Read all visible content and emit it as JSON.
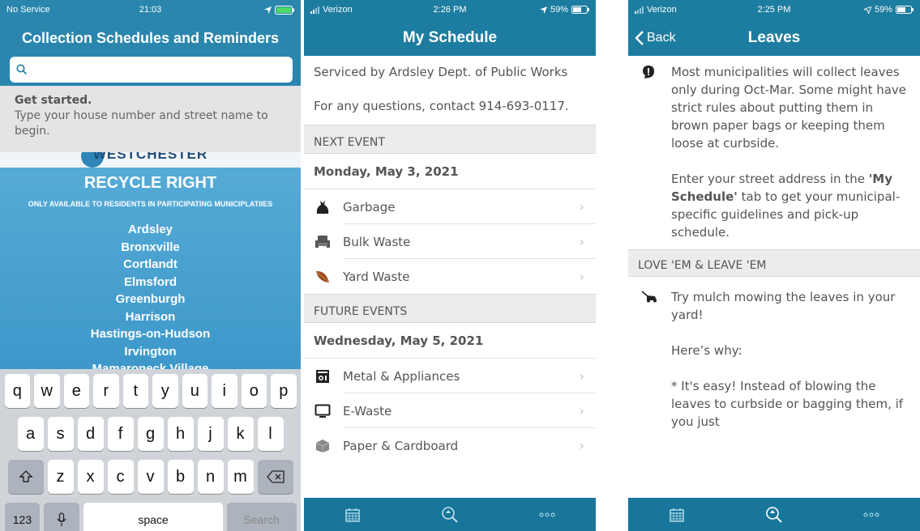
{
  "phone1": {
    "status": {
      "carrier": "No Service",
      "time": "21:03"
    },
    "title": "Collection Schedules and Reminders",
    "search": {
      "placeholder": "",
      "value": ""
    },
    "get_started": {
      "heading": "Get started.",
      "body": "Type your house number and street name to begin."
    },
    "poster": {
      "brand": "WESTCHESTER",
      "title": "RECYCLE RIGHT",
      "subtitle": "ONLY AVAILABLE TO RESIDENTS IN PARTICIPATING MUNICIPLATIIES",
      "municipalities": [
        "Ardsley",
        "Bronxville",
        "Cortlandt",
        "Elmsford",
        "Greenburgh",
        "Harrison",
        "Hastings-on-Hudson",
        "Irvington",
        "Mamaroneck Village"
      ]
    },
    "keyboard": {
      "row1": [
        "q",
        "w",
        "e",
        "r",
        "t",
        "y",
        "u",
        "i",
        "o",
        "p"
      ],
      "row2": [
        "a",
        "s",
        "d",
        "f",
        "g",
        "h",
        "j",
        "k",
        "l"
      ],
      "row3": [
        "z",
        "x",
        "c",
        "v",
        "b",
        "n",
        "m"
      ],
      "numbers_label": "123",
      "space_label": "space",
      "search_label": "Search"
    }
  },
  "phone2": {
    "status": {
      "carrier": "Verizon",
      "time": "2:26 PM",
      "battery": "59%"
    },
    "title": "My Schedule",
    "serviced_by": "Serviced by Ardsley Dept. of Public Works",
    "contact": "For any questions, contact 914-693-0117.",
    "next_event": {
      "label": "NEXT EVENT",
      "date": "Monday, May 3, 2021",
      "items": [
        {
          "label": "Garbage",
          "icon": "garbage-bag-icon"
        },
        {
          "label": "Bulk Waste",
          "icon": "armchair-icon"
        },
        {
          "label": "Yard Waste",
          "icon": "leaf-icon"
        }
      ]
    },
    "future_events": {
      "label": "FUTURE EVENTS",
      "date": "Wednesday, May 5, 2021",
      "items": [
        {
          "label": "Metal & Appliances",
          "icon": "appliance-icon"
        },
        {
          "label": "E-Waste",
          "icon": "monitor-icon"
        },
        {
          "label": "Paper & Cardboard",
          "icon": "cardboard-box-icon"
        }
      ]
    }
  },
  "phone3": {
    "status": {
      "carrier": "Verizon",
      "time": "2:25 PM",
      "battery": "59%"
    },
    "back_label": "Back",
    "title": "Leaves",
    "info_p1": "Most municipalities will collect leaves only during Oct-Mar. Some might have strict rules about putting them in brown paper bags or keeping them loose at curbside.",
    "info_p2_a": "Enter your street address in the ",
    "info_p2_b": "'My Schedule'",
    "info_p2_c": " tab to get your municipal-specific guidelines and pick-up schedule.",
    "section_label": "LOVE 'EM & LEAVE 'EM",
    "tip_p1": "Try mulch mowing the leaves in your yard!",
    "tip_p2": "Here’s why:",
    "tip_p3": "* It's easy! Instead of blowing the leaves to curbside or bagging them, if you just"
  },
  "colors": {
    "header": "#1d7da0",
    "tabbar": "#17769a"
  }
}
